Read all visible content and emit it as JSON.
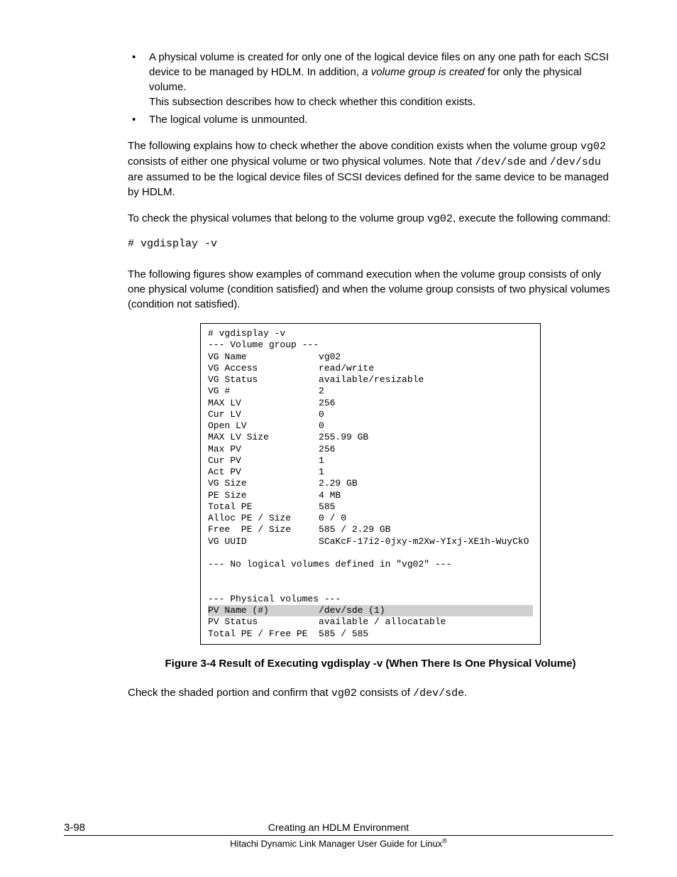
{
  "bullets": {
    "item1": {
      "text1": "A physical volume is created for only one of the logical device files on any one path for each SCSI device to be managed by HDLM. In addition, ",
      "italic": "a volume group is created",
      "text2": " for only the physical volume.",
      "sub": "This subsection describes how to check whether this condition exists."
    },
    "item2": "The logical volume is unmounted."
  },
  "para1": {
    "t1": "The following explains how to check whether the above condition exists when the volume group ",
    "m1": "vg02",
    "t2": " consists of either one physical volume or two physical volumes. Note that ",
    "m2": "/dev/sde",
    "t3": " and ",
    "m3": "/dev/sdu",
    "t4": " are assumed to be the logical device files of SCSI devices defined for the same device to be managed by HDLM."
  },
  "para2": {
    "t1": "To check the physical volumes that belong to the volume group ",
    "m1": "vg02",
    "t2": ", execute the following command:"
  },
  "command": "# vgdisplay -v",
  "para3": "The following figures show examples of command execution when the volume group consists of only one physical volume (condition satisfied) and when the volume group consists of two physical volumes (condition not satisfied).",
  "vg": {
    "l01": "# vgdisplay -v",
    "l02": "--- Volume group ---",
    "l03": "VG Name             vg02",
    "l04": "VG Access           read/write",
    "l05": "VG Status           available/resizable",
    "l06": "VG #                2",
    "l07": "MAX LV              256",
    "l08": "Cur LV              0",
    "l09": "Open LV             0",
    "l10": "MAX LV Size         255.99 GB",
    "l11": "Max PV              256",
    "l12": "Cur PV              1",
    "l13": "Act PV              1",
    "l14": "VG Size             2.29 GB",
    "l15": "PE Size             4 MB",
    "l16": "Total PE            585",
    "l17": "Alloc PE / Size     0 / 0",
    "l18": "Free  PE / Size     585 / 2.29 GB",
    "l19": "VG UUID             SCaKcF-17i2-0jxy-m2Xw-YIxj-XE1h-WuyCkO",
    "l20": " ",
    "l21": "--- No logical volumes defined in \"vg02\" ---",
    "l22": " ",
    "l23": " ",
    "l24": "--- Physical volumes ---",
    "l25": "PV Name (#)         /dev/sde (1)",
    "l26": "PV Status           available / allocatable",
    "l27": "Total PE / Free PE  585 / 585"
  },
  "figure_caption": "Figure 3-4 Result of Executing vgdisplay -v (When There Is One Physical Volume)",
  "para4": {
    "t1": "Check the shaded portion and confirm that ",
    "m1": "vg02",
    "t2": " consists of ",
    "m2": "/dev/sde",
    "t3": "."
  },
  "footer": {
    "page": "3-98",
    "title1": "Creating an HDLM Environment",
    "title2": "Hitachi Dynamic Link Manager User Guide for Linux",
    "reg": "®"
  }
}
